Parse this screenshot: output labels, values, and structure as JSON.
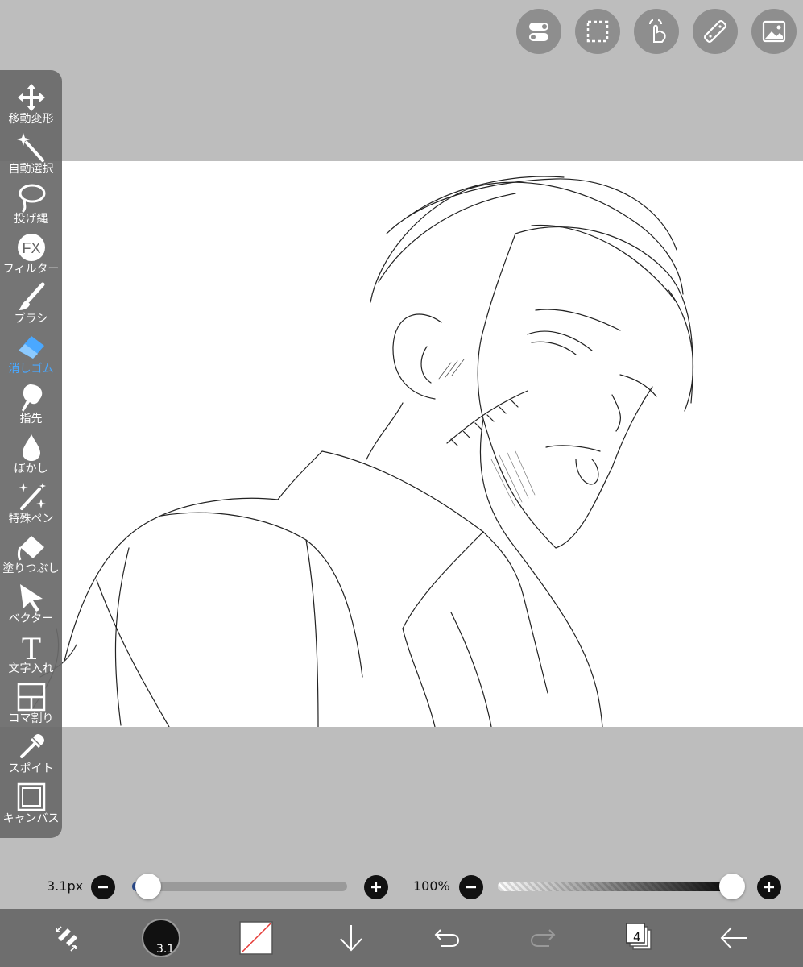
{
  "toolbar": {
    "tools": [
      {
        "label": "移動変形",
        "icon": "move-icon"
      },
      {
        "label": "自動選択",
        "icon": "magic-wand-icon"
      },
      {
        "label": "投げ縄",
        "icon": "lasso-icon"
      },
      {
        "label": "フィルター",
        "icon": "fx-icon",
        "icon_text": "FX"
      },
      {
        "label": "ブラシ",
        "icon": "brush-icon"
      },
      {
        "label": "消しゴム",
        "icon": "eraser-icon",
        "active": true
      },
      {
        "label": "指先",
        "icon": "smudge-icon"
      },
      {
        "label": "ぼかし",
        "icon": "blur-drop-icon"
      },
      {
        "label": "特殊ペン",
        "icon": "special-pen-icon"
      },
      {
        "label": "塗りつぶし",
        "icon": "fill-bucket-icon"
      },
      {
        "label": "ベクター",
        "icon": "vector-arrow-icon"
      },
      {
        "label": "文字入れ",
        "icon": "text-icon",
        "icon_text": "T"
      },
      {
        "label": "コマ割り",
        "icon": "panel-divide-icon"
      },
      {
        "label": "スポイト",
        "icon": "eyedropper-icon"
      },
      {
        "label": "キャンバス",
        "icon": "canvas-icon"
      }
    ],
    "active_color": "#4aa8ff"
  },
  "top_buttons": [
    "toggle-icon",
    "selection-icon",
    "touch-gesture-icon",
    "ruler-icon",
    "image-icon"
  ],
  "size_slider": {
    "value_label": "3.1px",
    "level": 0.03
  },
  "opacity_slider": {
    "value_label": "100%",
    "level": 1.0
  },
  "bottom_bar": {
    "brush_size_label": "3.1",
    "layer_count": "4",
    "icons": [
      "swap-colors-icon",
      "brush-size-icon",
      "color-swatch-icon",
      "download-arrow-icon",
      "undo-icon",
      "redo-icon",
      "layers-icon",
      "back-arrow-icon"
    ]
  }
}
